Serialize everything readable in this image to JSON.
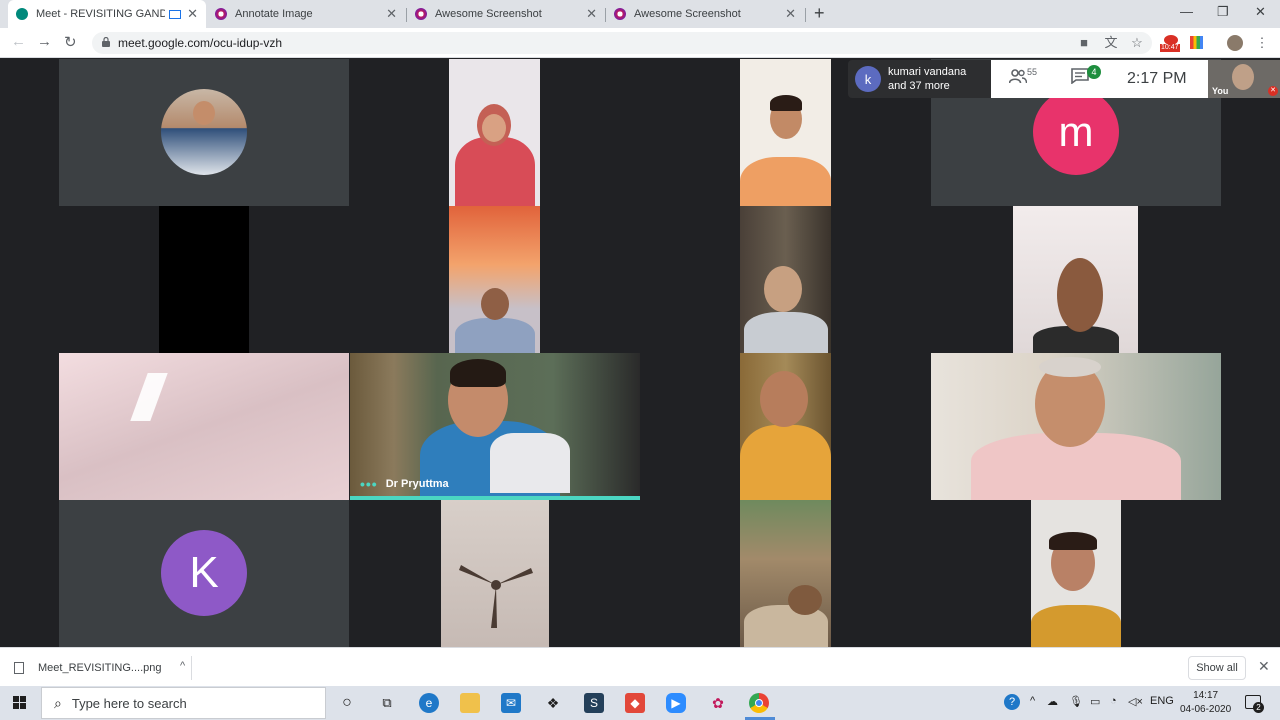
{
  "browser": {
    "tabs": [
      {
        "title": "Meet - REVISITING GANDHI",
        "active": true,
        "fav": "#00897b"
      },
      {
        "title": "Annotate Image",
        "active": false,
        "fav": "#c2185b"
      },
      {
        "title": "Awesome Screenshot",
        "active": false,
        "fav": "#c2185b"
      },
      {
        "title": "Awesome Screenshot",
        "active": false,
        "fav": "#c2185b"
      }
    ],
    "new_tab": "+",
    "url": "meet.google.com/ocu-idup-vzh",
    "ext_badge": "10:47"
  },
  "meet": {
    "participants_label": "kumari vandana",
    "participants_more": "and 37 more",
    "participants_initial": "k",
    "people_count": "55",
    "chat_count": "4",
    "time": "2:17 PM",
    "self_label": "You",
    "speaker_name": "Dr Pryuttma",
    "avatar_m": "m",
    "avatar_k": "K",
    "colors": {
      "avatar_m": "#e8336b",
      "avatar_k": "#8e59c7",
      "speaking": "#4bd6c2"
    }
  },
  "downloads": {
    "file": "Meet_REVISITING....png",
    "show_all": "Show all"
  },
  "taskbar": {
    "search_placeholder": "Type here to search",
    "lang": "ENG",
    "time": "14:17",
    "date": "04-06-2020",
    "notif_count": "2"
  }
}
